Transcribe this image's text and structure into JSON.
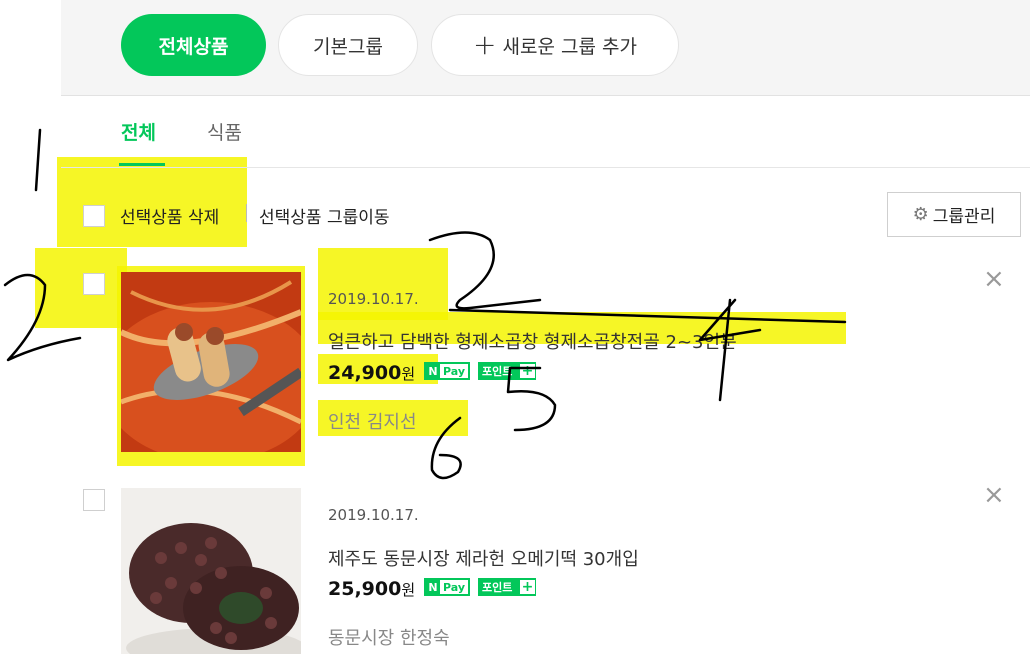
{
  "group_bar": {
    "all_label": "전체상품",
    "basic_label": "기본그룹",
    "new_label": "새로운 그룹 추가"
  },
  "tabs": [
    {
      "label": "전체",
      "active": true
    },
    {
      "label": "식품",
      "active": false
    }
  ],
  "toolbar": {
    "delete_label": "선택상품 삭제",
    "move_label": "선택상품 그룹이동",
    "manage_label": "그룹관리"
  },
  "products": [
    {
      "date": "2019.10.17.",
      "title": "얼큰하고 담백한 형제소곱창 형제소곱창전골 2~3인분",
      "price": "24,900",
      "currency": "원",
      "npay_n": "N",
      "npay_label": "Pay",
      "point_label": "포인트",
      "seller": "인천 김지선"
    },
    {
      "date": "2019.10.17.",
      "title": "제주도 동문시장 제라헌 오메기떡 30개입",
      "price": "25,900",
      "currency": "원",
      "npay_n": "N",
      "npay_label": "Pay",
      "point_label": "포인트",
      "seller": "동문시장 한정숙"
    }
  ],
  "annotations": [
    "1",
    "2",
    "3",
    "4",
    "5",
    "6"
  ],
  "colors": {
    "accent": "#03c75a",
    "highlight": "#f4f400"
  }
}
